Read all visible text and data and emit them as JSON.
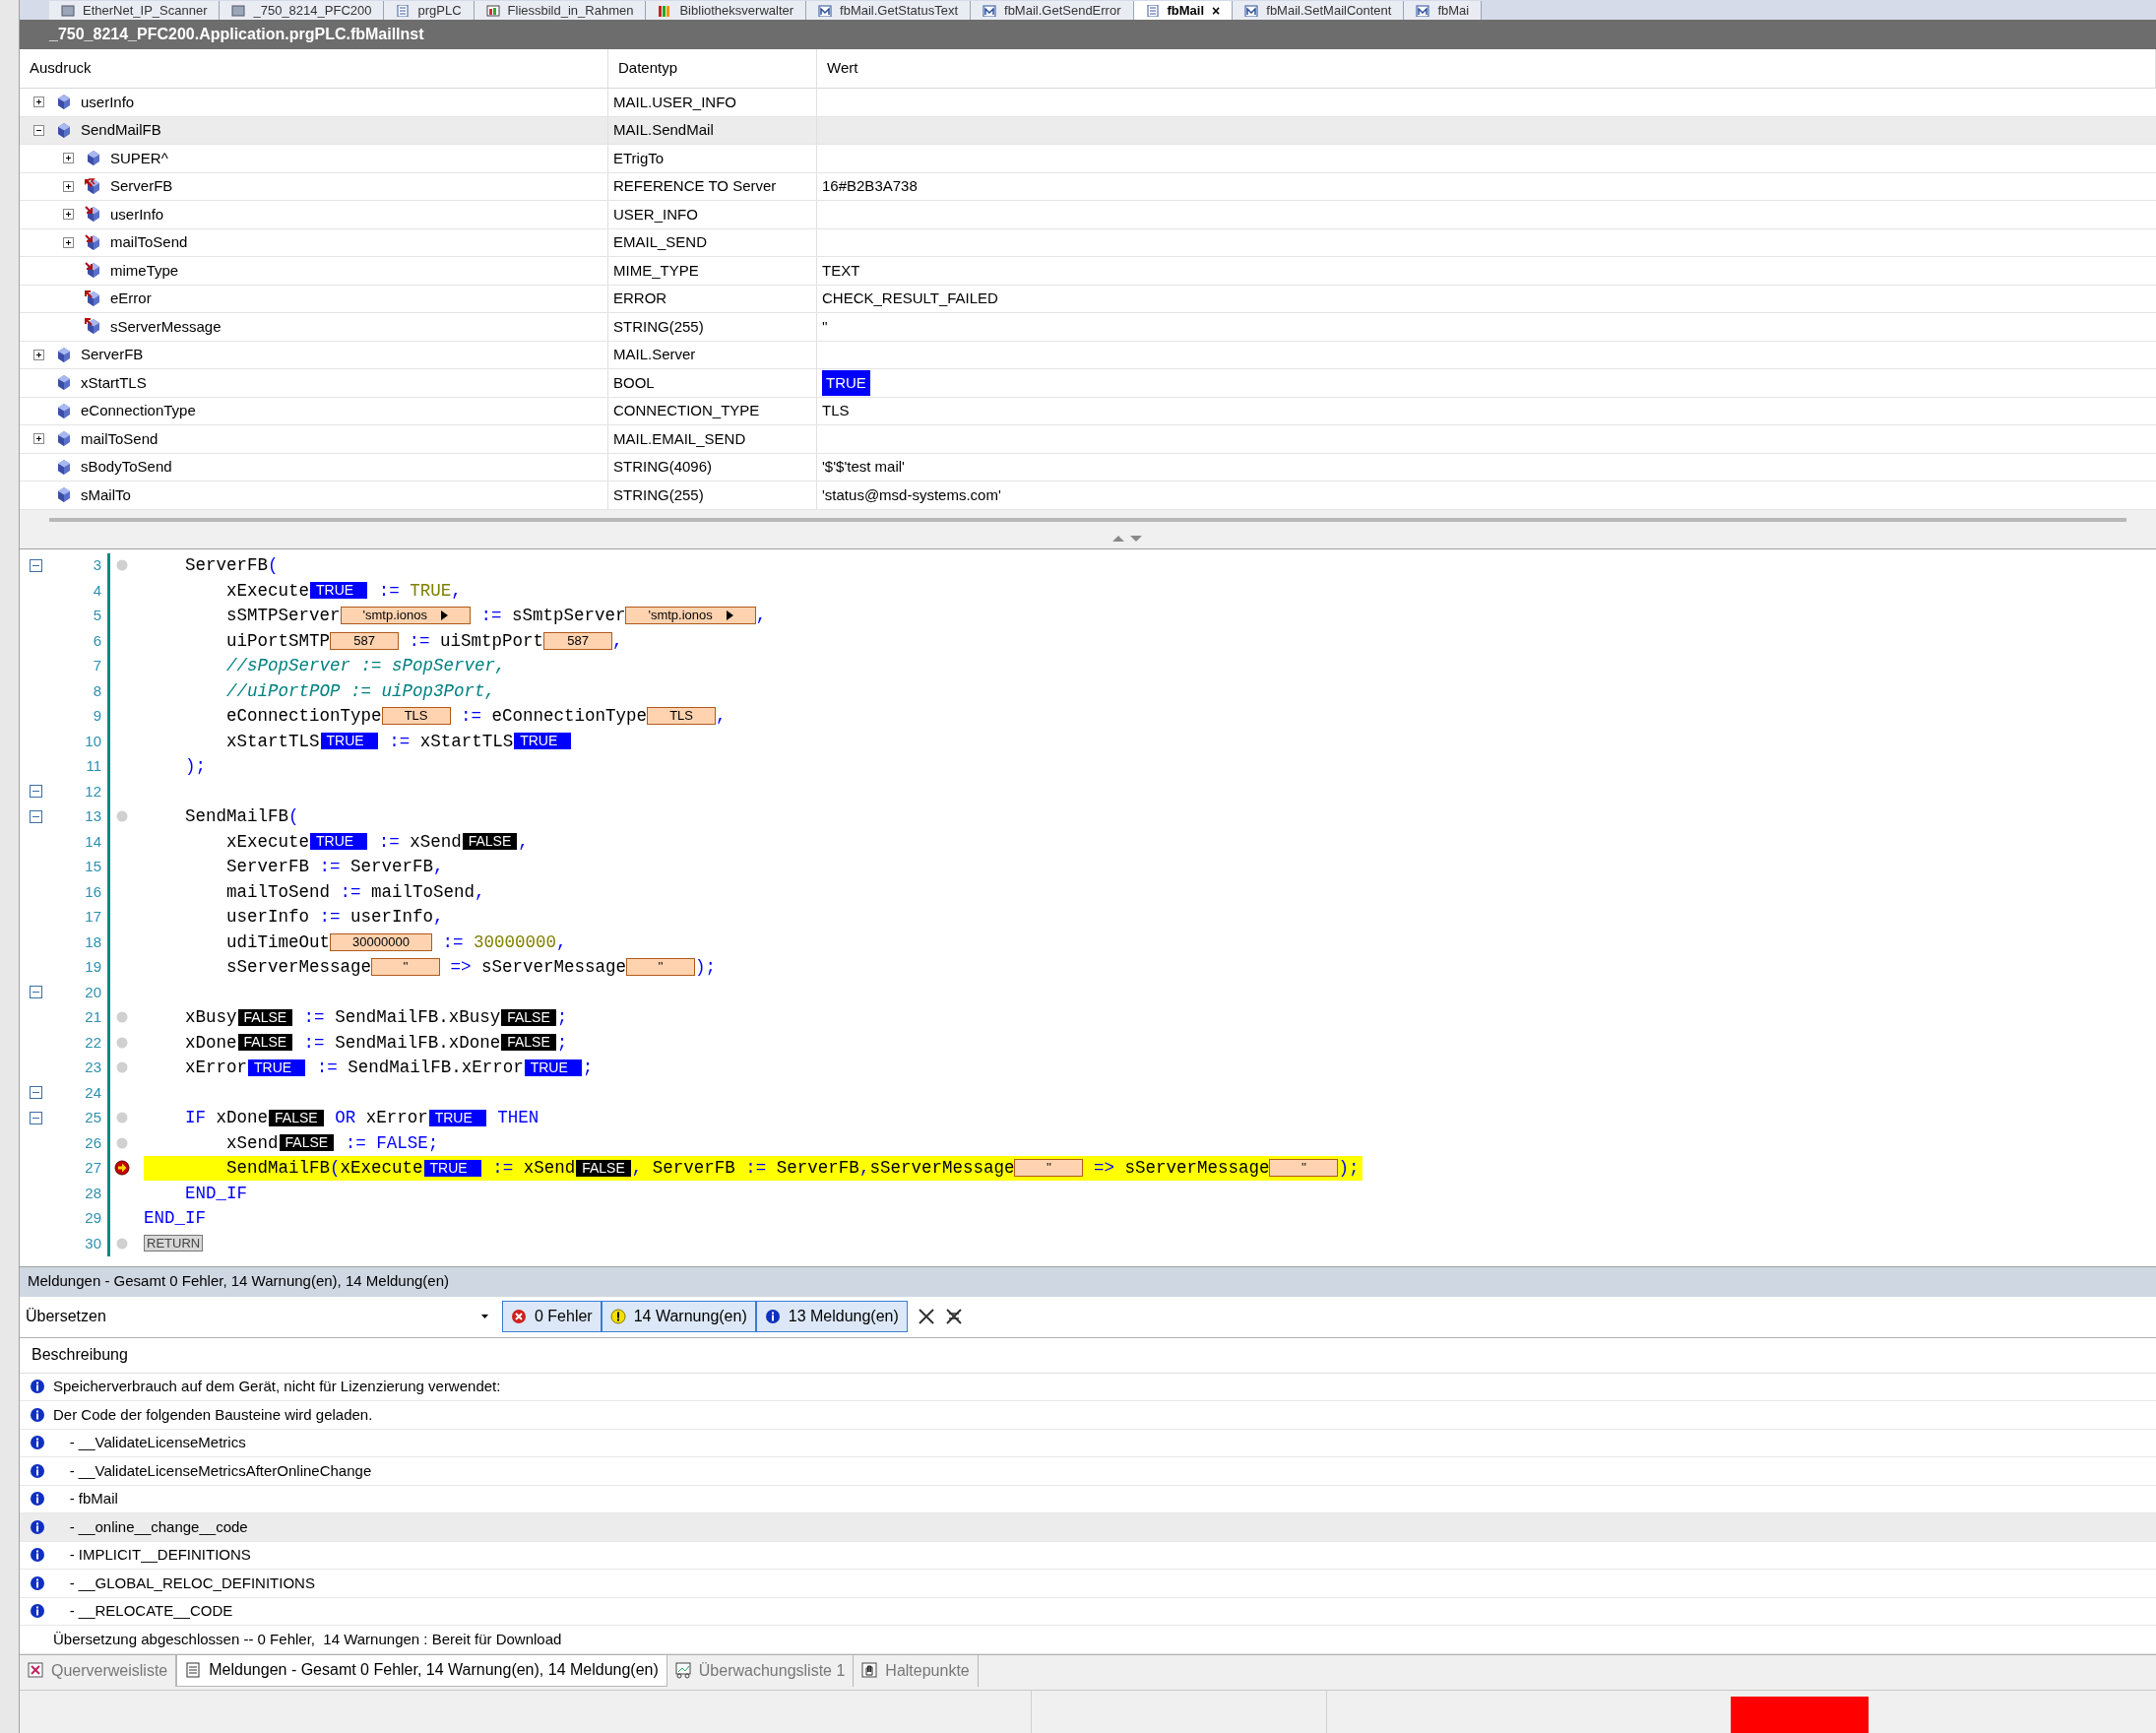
{
  "editor_tabs": [
    {
      "label": "EtherNet_IP_Scanner",
      "selected": false,
      "kind": "device"
    },
    {
      "label": "_750_8214_PFC200",
      "selected": false,
      "kind": "device"
    },
    {
      "label": "prgPLC",
      "selected": false,
      "kind": "pou"
    },
    {
      "label": "Fliessbild_in_Rahmen",
      "selected": false,
      "kind": "visu"
    },
    {
      "label": "Bibliotheksverwalter",
      "selected": false,
      "kind": "library"
    },
    {
      "label": "fbMail.GetStatusText",
      "selected": false,
      "kind": "method"
    },
    {
      "label": "fbMail.GetSendError",
      "selected": false,
      "kind": "method"
    },
    {
      "label": "fbMail",
      "selected": true,
      "kind": "pou",
      "close": "×"
    },
    {
      "label": "fbMail.SetMailContent",
      "selected": false,
      "kind": "method"
    },
    {
      "label": "fbMai",
      "selected": false,
      "kind": "method"
    }
  ],
  "title": "_750_8214_PFC200.Application.prgPLC.fbMailInst",
  "watch_table": {
    "columns": [
      "Ausdruck",
      "Datentyp",
      "Wert"
    ],
    "rows": [
      {
        "expression": "userInfo",
        "kind": "var",
        "type": "MAIL.USER_INFO",
        "expanded": false,
        "selected": false
      },
      {
        "expression": "SendMailFB",
        "kind": "var",
        "type": "MAIL.SendMail",
        "expanded": true,
        "selected": true,
        "children": [
          {
            "expression": "SUPER^",
            "kind": "var",
            "type": "ETrigTo",
            "expanded": false,
            "selected": false
          },
          {
            "expression": "ServerFB",
            "kind": "ref",
            "type": "REFERENCE TO Server",
            "value": "16#B2B3A738",
            "expanded": false,
            "selected": false
          },
          {
            "expression": "userInfo",
            "kind": "input",
            "type": "USER_INFO",
            "expanded": false,
            "selected": false
          },
          {
            "expression": "mailToSend",
            "kind": "input",
            "type": "EMAIL_SEND",
            "expanded": false,
            "selected": false
          },
          {
            "expression": "mimeType",
            "kind": "input",
            "type": "MIME_TYPE",
            "value": "TEXT",
            "selected": false
          },
          {
            "expression": "eError",
            "kind": "output",
            "type": "ERROR",
            "value": "CHECK_RESULT_FAILED",
            "selected": false
          },
          {
            "expression": "sServerMessage",
            "kind": "output",
            "type": "STRING(255)",
            "value": "''",
            "selected": false
          }
        ]
      },
      {
        "expression": "ServerFB",
        "kind": "var",
        "type": "MAIL.Server",
        "expanded": false,
        "selected": false
      },
      {
        "expression": "xStartTLS",
        "kind": "var",
        "type": "BOOL",
        "value": "TRUE",
        "highlighted": true,
        "selected": false
      },
      {
        "expression": "eConnectionType",
        "kind": "var",
        "type": "CONNECTION_TYPE",
        "value": "TLS",
        "selected": false
      },
      {
        "expression": "mailToSend",
        "kind": "var",
        "type": "MAIL.EMAIL_SEND",
        "expanded": false,
        "selected": false
      },
      {
        "expression": "sBodyToSend",
        "kind": "var",
        "type": "STRING(4096)",
        "value": "'$'$'test mail'",
        "selected": false
      },
      {
        "expression": "sMailTo",
        "kind": "var",
        "type": "STRING(255)",
        "value": "'status@msd-systems.com'",
        "selected": false
      }
    ]
  },
  "code_lines": [
    {
      "number": "3",
      "fold": true,
      "breakpoint_slot": true,
      "segments": [
        {
          "kind": "id",
          "text": "    ServerFB"
        },
        {
          "kind": "op",
          "text": "("
        }
      ]
    },
    {
      "number": "4",
      "segments": [
        {
          "kind": "id",
          "text": "        xExecute"
        },
        {
          "kind": "bool",
          "text": "TRUE"
        },
        {
          "kind": "op",
          "text": " := "
        },
        {
          "kind": "lit",
          "text": "TRUE"
        },
        {
          "kind": "op",
          "text": ","
        }
      ]
    },
    {
      "number": "5",
      "segments": [
        {
          "kind": "id",
          "text": "        sSMTPServer"
        },
        {
          "kind": "value",
          "text": "'smtp.ionos",
          "more": true
        },
        {
          "kind": "op",
          "text": " := "
        },
        {
          "kind": "id",
          "text": "sSmtpServer"
        },
        {
          "kind": "value",
          "text": "'smtp.ionos",
          "more": true
        },
        {
          "kind": "op",
          "text": ","
        }
      ]
    },
    {
      "number": "6",
      "segments": [
        {
          "kind": "id",
          "text": "        uiPortSMTP"
        },
        {
          "kind": "value",
          "text": "587"
        },
        {
          "kind": "op",
          "text": " := "
        },
        {
          "kind": "id",
          "text": "uiSmtpPort"
        },
        {
          "kind": "value",
          "text": "587"
        },
        {
          "kind": "op",
          "text": ","
        }
      ]
    },
    {
      "number": "7",
      "segments": [
        {
          "kind": "comment",
          "text": "        //sPopServer := sPopServer,"
        }
      ]
    },
    {
      "number": "8",
      "segments": [
        {
          "kind": "comment",
          "text": "        //uiPortPOP := uiPop3Port,"
        }
      ]
    },
    {
      "number": "9",
      "segments": [
        {
          "kind": "id",
          "text": "        eConnectionType"
        },
        {
          "kind": "value",
          "text": "TLS"
        },
        {
          "kind": "op",
          "text": " := "
        },
        {
          "kind": "id",
          "text": "eConnectionType"
        },
        {
          "kind": "value",
          "text": "TLS"
        },
        {
          "kind": "op",
          "text": ","
        }
      ]
    },
    {
      "number": "10",
      "segments": [
        {
          "kind": "id",
          "text": "        xStartTLS"
        },
        {
          "kind": "bool",
          "text": "TRUE"
        },
        {
          "kind": "op",
          "text": " := "
        },
        {
          "kind": "id",
          "text": "xStartTLS"
        },
        {
          "kind": "bool",
          "text": "TRUE"
        }
      ]
    },
    {
      "number": "11",
      "segments": [
        {
          "kind": "op",
          "text": "    );"
        }
      ]
    },
    {
      "number": "12",
      "fold": true
    },
    {
      "number": "13",
      "fold": true,
      "breakpoint_slot": true,
      "segments": [
        {
          "kind": "id",
          "text": "    SendMailFB"
        },
        {
          "kind": "op",
          "text": "("
        }
      ]
    },
    {
      "number": "14",
      "segments": [
        {
          "kind": "id",
          "text": "        xExecute"
        },
        {
          "kind": "bool",
          "text": "TRUE"
        },
        {
          "kind": "op",
          "text": " := "
        },
        {
          "kind": "id",
          "text": "xSend"
        },
        {
          "kind": "bool",
          "text": "FALSE"
        },
        {
          "kind": "op",
          "text": ","
        }
      ]
    },
    {
      "number": "15",
      "segments": [
        {
          "kind": "id",
          "text": "        ServerFB"
        },
        {
          "kind": "op",
          "text": " := "
        },
        {
          "kind": "id",
          "text": "ServerFB"
        },
        {
          "kind": "op",
          "text": ","
        }
      ]
    },
    {
      "number": "16",
      "segments": [
        {
          "kind": "id",
          "text": "        mailToSend"
        },
        {
          "kind": "op",
          "text": " := "
        },
        {
          "kind": "id",
          "text": "mailToSend"
        },
        {
          "kind": "op",
          "text": ","
        }
      ]
    },
    {
      "number": "17",
      "segments": [
        {
          "kind": "id",
          "text": "        userInfo"
        },
        {
          "kind": "op",
          "text": " := "
        },
        {
          "kind": "id",
          "text": "userInfo"
        },
        {
          "kind": "op",
          "text": ","
        }
      ]
    },
    {
      "number": "18",
      "segments": [
        {
          "kind": "id",
          "text": "        udiTimeOut"
        },
        {
          "kind": "value",
          "text": "30000000"
        },
        {
          "kind": "op",
          "text": " := "
        },
        {
          "kind": "lit",
          "text": "30000000"
        },
        {
          "kind": "op",
          "text": ","
        }
      ]
    },
    {
      "number": "19",
      "segments": [
        {
          "kind": "id",
          "text": "        sServerMessage"
        },
        {
          "kind": "value",
          "text": "''"
        },
        {
          "kind": "op",
          "text": " => "
        },
        {
          "kind": "id",
          "text": "sServerMessage"
        },
        {
          "kind": "value",
          "text": "''"
        },
        {
          "kind": "op",
          "text": ");"
        }
      ]
    },
    {
      "number": "20",
      "fold": true
    },
    {
      "number": "21",
      "breakpoint_slot": true,
      "segments": [
        {
          "kind": "id",
          "text": "    xBusy"
        },
        {
          "kind": "bool",
          "text": "FALSE"
        },
        {
          "kind": "op",
          "text": " := "
        },
        {
          "kind": "id",
          "text": "SendMailFB.xBusy"
        },
        {
          "kind": "bool",
          "text": "FALSE"
        },
        {
          "kind": "op",
          "text": ";"
        }
      ]
    },
    {
      "number": "22",
      "breakpoint_slot": true,
      "segments": [
        {
          "kind": "id",
          "text": "    xDone"
        },
        {
          "kind": "bool",
          "text": "FALSE"
        },
        {
          "kind": "op",
          "text": " := "
        },
        {
          "kind": "id",
          "text": "SendMailFB.xDone"
        },
        {
          "kind": "bool",
          "text": "FALSE"
        },
        {
          "kind": "op",
          "text": ";"
        }
      ]
    },
    {
      "number": "23",
      "breakpoint_slot": true,
      "segments": [
        {
          "kind": "id",
          "text": "    xError"
        },
        {
          "kind": "bool",
          "text": "TRUE"
        },
        {
          "kind": "op",
          "text": " := "
        },
        {
          "kind": "id",
          "text": "SendMailFB.xError"
        },
        {
          "kind": "bool",
          "text": "TRUE"
        },
        {
          "kind": "op",
          "text": ";"
        }
      ]
    },
    {
      "number": "24",
      "fold": true
    },
    {
      "number": "25",
      "fold": true,
      "breakpoint_slot": true,
      "segments": [
        {
          "kind": "kw",
          "text": "    IF "
        },
        {
          "kind": "id",
          "text": "xDone"
        },
        {
          "kind": "bool",
          "text": "FALSE"
        },
        {
          "kind": "kw",
          "text": " OR "
        },
        {
          "kind": "id",
          "text": "xError"
        },
        {
          "kind": "bool",
          "text": "TRUE"
        },
        {
          "kind": "kw",
          "text": " THEN"
        }
      ]
    },
    {
      "number": "26",
      "breakpoint_slot": true,
      "segments": [
        {
          "kind": "id",
          "text": "        xSend"
        },
        {
          "kind": "bool",
          "text": "FALSE"
        },
        {
          "kind": "op",
          "text": " := "
        },
        {
          "kind": "kw",
          "text": "FALSE"
        },
        {
          "kind": "op",
          "text": ";"
        }
      ]
    },
    {
      "number": "27",
      "breakpoint_slot": true,
      "current": true,
      "segments": [
        {
          "kind": "id",
          "text": "        SendMailFB"
        },
        {
          "kind": "op",
          "text": "("
        },
        {
          "kind": "id",
          "text": "xExecute"
        },
        {
          "kind": "bool",
          "text": "TRUE"
        },
        {
          "kind": "op",
          "text": " := "
        },
        {
          "kind": "id",
          "text": "xSend"
        },
        {
          "kind": "bool",
          "text": "FALSE"
        },
        {
          "kind": "op",
          "text": ", "
        },
        {
          "kind": "id",
          "text": "ServerFB"
        },
        {
          "kind": "op",
          "text": " := "
        },
        {
          "kind": "id",
          "text": "ServerFB"
        },
        {
          "kind": "op",
          "text": ","
        },
        {
          "kind": "id",
          "text": "sServerMessage"
        },
        {
          "kind": "value",
          "text": "''"
        },
        {
          "kind": "op",
          "text": " => "
        },
        {
          "kind": "id",
          "text": "sServerMessage"
        },
        {
          "kind": "value",
          "text": "''"
        },
        {
          "kind": "op",
          "text": ");"
        }
      ]
    },
    {
      "number": "28",
      "segments": [
        {
          "kind": "kw",
          "text": "    END_IF"
        }
      ]
    },
    {
      "number": "29",
      "segments": [
        {
          "kind": "kw",
          "text": "END_IF"
        }
      ]
    },
    {
      "number": "30",
      "breakpoint_slot": true,
      "segments": [
        {
          "kind": "return",
          "text": "RETURN"
        }
      ]
    }
  ],
  "messages": {
    "header": "Meldungen - Gesamt 0 Fehler, 14 Warnung(en), 14 Meldung(en)",
    "category": "Übersetzen",
    "filters": [
      {
        "kind": "error",
        "label": "0 Fehler",
        "selected": true
      },
      {
        "kind": "warning",
        "label": "14 Warnung(en)",
        "selected": true
      },
      {
        "kind": "info",
        "label": "13 Meldung(en)",
        "selected": true
      }
    ],
    "column": "Beschreibung",
    "rows": [
      {
        "kind": "info",
        "text": "Speicherverbrauch auf dem Gerät, nicht für Lizenzierung verwendet:",
        "selected": false
      },
      {
        "kind": "info",
        "text": "Der Code der folgenden Bausteine wird geladen.",
        "selected": false
      },
      {
        "kind": "info",
        "text": "    - __ValidateLicenseMetrics",
        "selected": false
      },
      {
        "kind": "info",
        "text": "    - __ValidateLicenseMetricsAfterOnlineChange",
        "selected": false
      },
      {
        "kind": "info",
        "text": "    - fbMail",
        "selected": false
      },
      {
        "kind": "info",
        "text": "    - __online__change__code",
        "selected": true
      },
      {
        "kind": "info",
        "text": "    - IMPLICIT__DEFINITIONS",
        "selected": false
      },
      {
        "kind": "info",
        "text": "    - __GLOBAL_RELOC_DEFINITIONS",
        "selected": false
      },
      {
        "kind": "info",
        "text": "    - __RELOCATE__CODE",
        "selected": false
      },
      {
        "kind": "plain",
        "text": "Übersetzung abgeschlossen -- 0 Fehler,  14 Warnungen : Bereit für Download",
        "selected": false
      }
    ]
  },
  "bottom_tabs": [
    {
      "label": "Querverweisliste",
      "kind": "xref",
      "selected": false
    },
    {
      "label": "Meldungen - Gesamt 0 Fehler, 14 Warnung(en), 14 Meldung(en)",
      "kind": "messages",
      "selected": true
    },
    {
      "label": "Überwachungsliste 1",
      "kind": "watch",
      "selected": false
    },
    {
      "label": "Haltepunkte",
      "kind": "breakpoints",
      "selected": false
    }
  ]
}
